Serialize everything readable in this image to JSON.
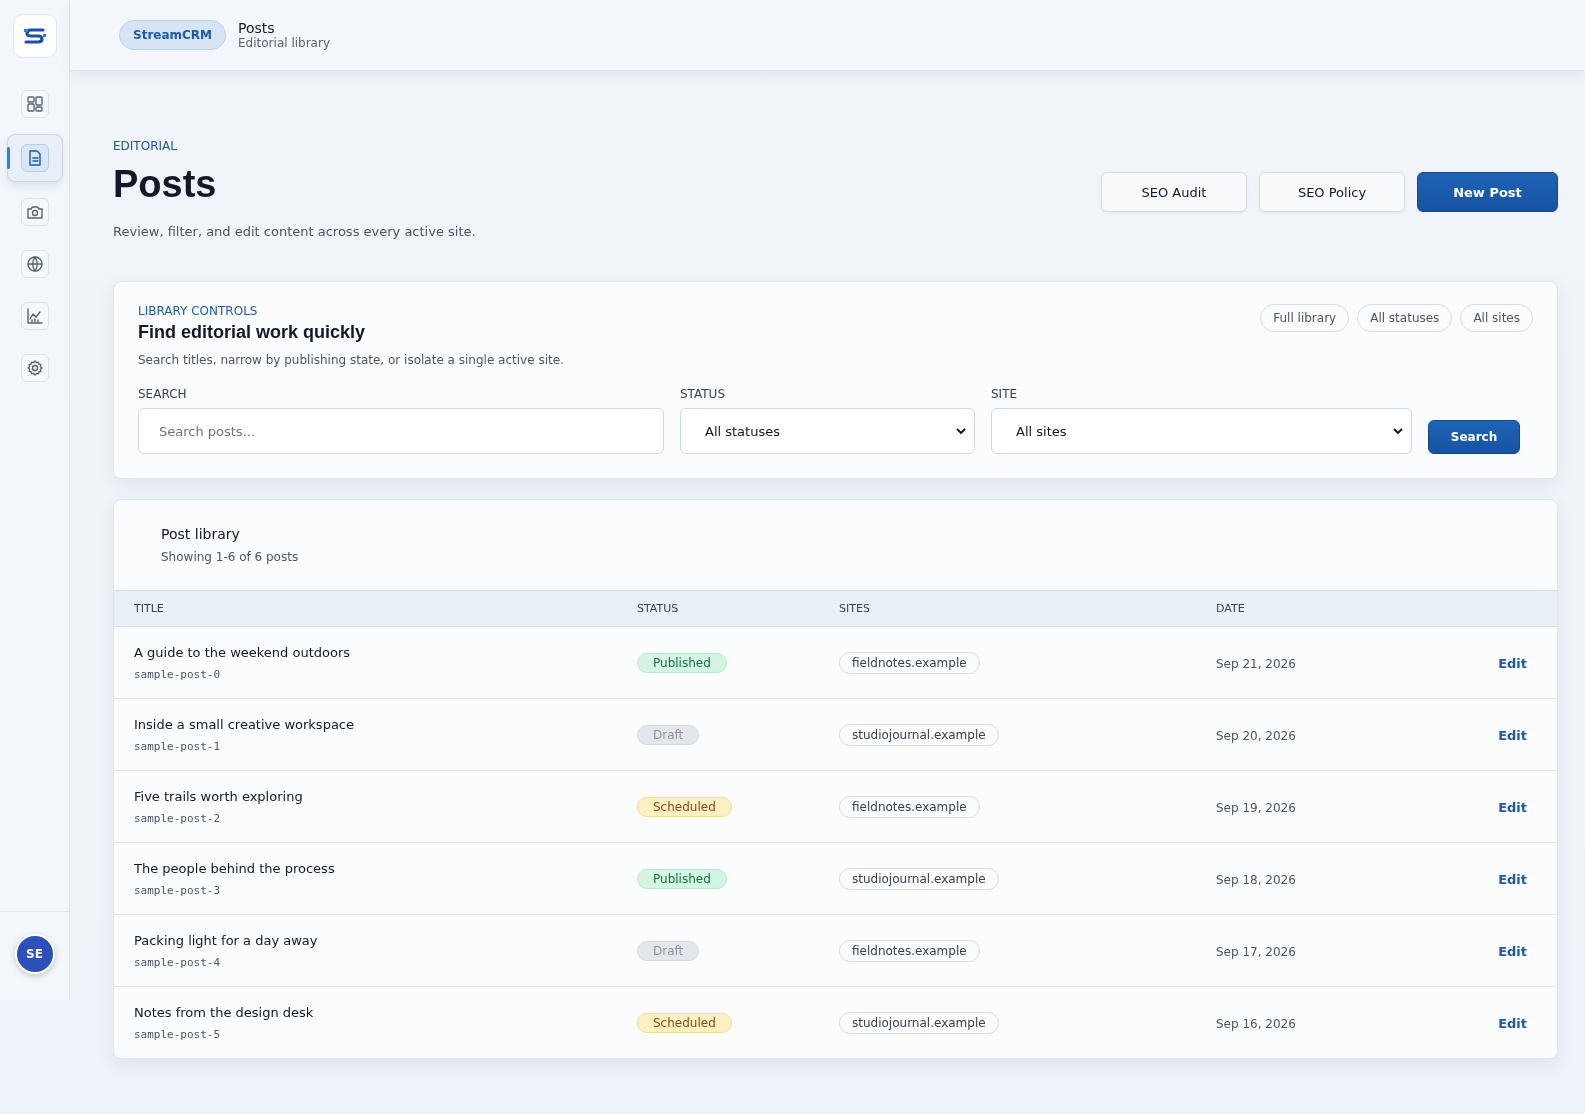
{
  "sidebar": {
    "items": [
      {
        "kind": "dashboard",
        "selected": false
      },
      {
        "kind": "document",
        "selected": true
      },
      {
        "kind": "camera",
        "selected": false
      },
      {
        "kind": "globe",
        "selected": false
      },
      {
        "kind": "chart",
        "selected": false
      },
      {
        "kind": "settings",
        "selected": false
      }
    ],
    "avatar": "SE"
  },
  "topbar": {
    "brand": "StreamCRM",
    "title": "Posts",
    "subtitle": "Editorial library"
  },
  "header": {
    "eyebrow": "EDITORIAL",
    "title": "Posts",
    "description": "Review, filter, and edit content across every active site.",
    "buttons": [
      {
        "label": "SEO Audit",
        "kind": "secondary"
      },
      {
        "label": "SEO Policy",
        "kind": "secondary"
      },
      {
        "label": "New Post",
        "kind": "primary"
      }
    ]
  },
  "controls": {
    "eyebrow": "LIBRARY CONTROLS",
    "title": "Find editorial work quickly",
    "description": "Search titles, narrow by publishing state, or isolate a single active site.",
    "chips": [
      "Full library",
      "All statuses",
      "All sites"
    ],
    "search": {
      "label": "SEARCH",
      "placeholder": "Search posts..."
    },
    "status": {
      "label": "STATUS",
      "value": "All statuses"
    },
    "site": {
      "label": "SITE",
      "value": "All sites"
    },
    "button": "Search"
  },
  "library": {
    "title": "Post library",
    "count": "Showing 1-6 of 6 posts",
    "columns": [
      "TITLE",
      "STATUS",
      "SITES",
      "DATE"
    ],
    "rows": [
      {
        "title": "A guide to the weekend outdoors",
        "slug": "sample-post-0",
        "status": "Published",
        "kind": "published",
        "site": "fieldnotes.example",
        "date": "Sep 21, 2026",
        "action": "Edit"
      },
      {
        "title": "Inside a small creative workspace",
        "slug": "sample-post-1",
        "status": "Draft",
        "kind": "draft",
        "site": "studiojournal.example",
        "date": "Sep 20, 2026",
        "action": "Edit"
      },
      {
        "title": "Five trails worth exploring",
        "slug": "sample-post-2",
        "status": "Scheduled",
        "kind": "scheduled",
        "site": "fieldnotes.example",
        "date": "Sep 19, 2026",
        "action": "Edit"
      },
      {
        "title": "The people behind the process",
        "slug": "sample-post-3",
        "status": "Published",
        "kind": "published",
        "site": "studiojournal.example",
        "date": "Sep 18, 2026",
        "action": "Edit"
      },
      {
        "title": "Packing light for a day away",
        "slug": "sample-post-4",
        "status": "Draft",
        "kind": "draft",
        "site": "fieldnotes.example",
        "date": "Sep 17, 2026",
        "action": "Edit"
      },
      {
        "title": "Notes from the design desk",
        "slug": "sample-post-5",
        "status": "Scheduled",
        "kind": "scheduled",
        "site": "studiojournal.example",
        "date": "Sep 16, 2026",
        "action": "Edit"
      }
    ]
  }
}
